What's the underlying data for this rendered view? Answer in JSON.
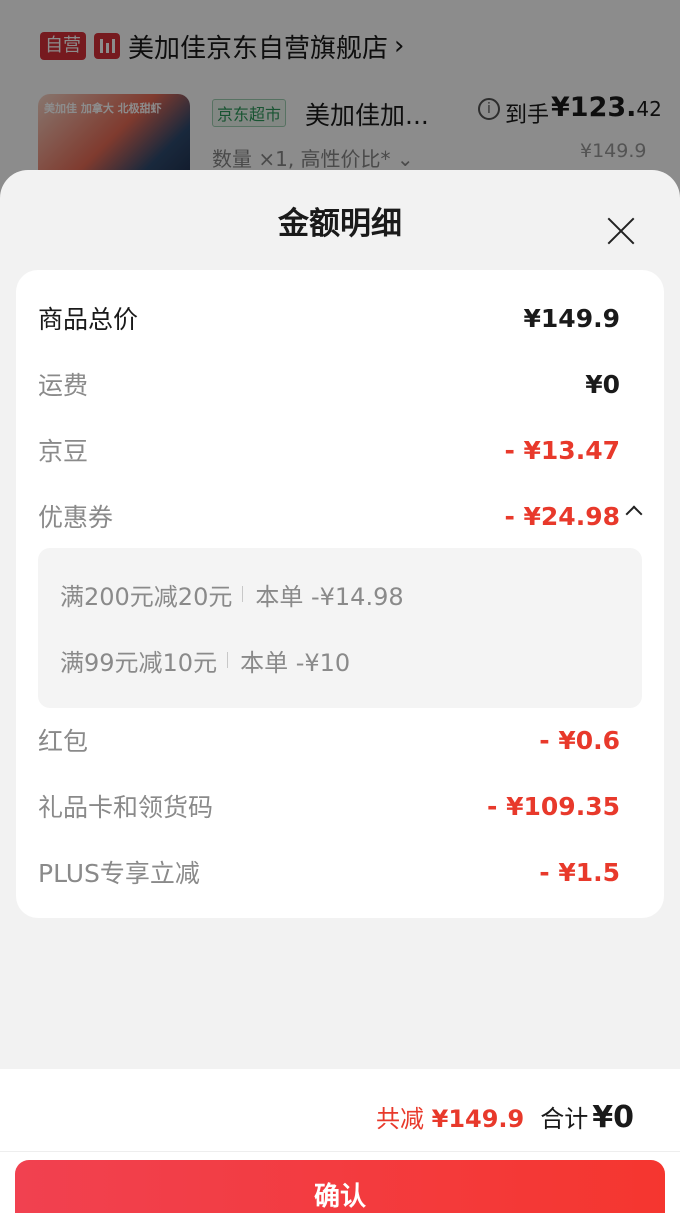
{
  "store": {
    "badge": "自营",
    "name": "美加佳京东自营旗舰店",
    "chevron": "›"
  },
  "product": {
    "thumb_text": "美加佳 加拿大 北极甜虾",
    "channel_tag": "京东超市",
    "name": "美加佳加...",
    "spec": "数量 ×1, 高性价比* ⌄",
    "final_label": "到手",
    "final_price_main": "¥123.",
    "final_price_cents": "42",
    "orig_price": "¥149.9"
  },
  "sheet": {
    "title": "金额明细",
    "close_icon": "close-icon"
  },
  "rows": [
    {
      "label": "商品总价",
      "value": "¥149.9"
    },
    {
      "label": "运费",
      "value": "¥0"
    },
    {
      "label": "京豆",
      "value": "- ¥13.47"
    },
    {
      "label": "优惠券",
      "value": "- ¥24.98"
    },
    {
      "label": "红包",
      "value": "- ¥0.6"
    },
    {
      "label": "礼品卡和领货码",
      "value": "- ¥109.35"
    },
    {
      "label": "PLUS专享立减",
      "value": "- ¥1.5"
    }
  ],
  "coupons": [
    {
      "rule": "满200元减20元",
      "detail": "本单 -¥14.98"
    },
    {
      "rule": "满99元减10元",
      "detail": "本单 -¥10"
    }
  ],
  "footer": {
    "reduce_label": "共减",
    "reduce_value": "¥149.9",
    "sum_label": "合计",
    "sum_currency": "¥",
    "sum_value": "0",
    "confirm_label": "确认"
  },
  "colors": {
    "accent_red": "#e8392b",
    "badge_red": "#d8303a",
    "jd_green": "#2f9a5c"
  }
}
